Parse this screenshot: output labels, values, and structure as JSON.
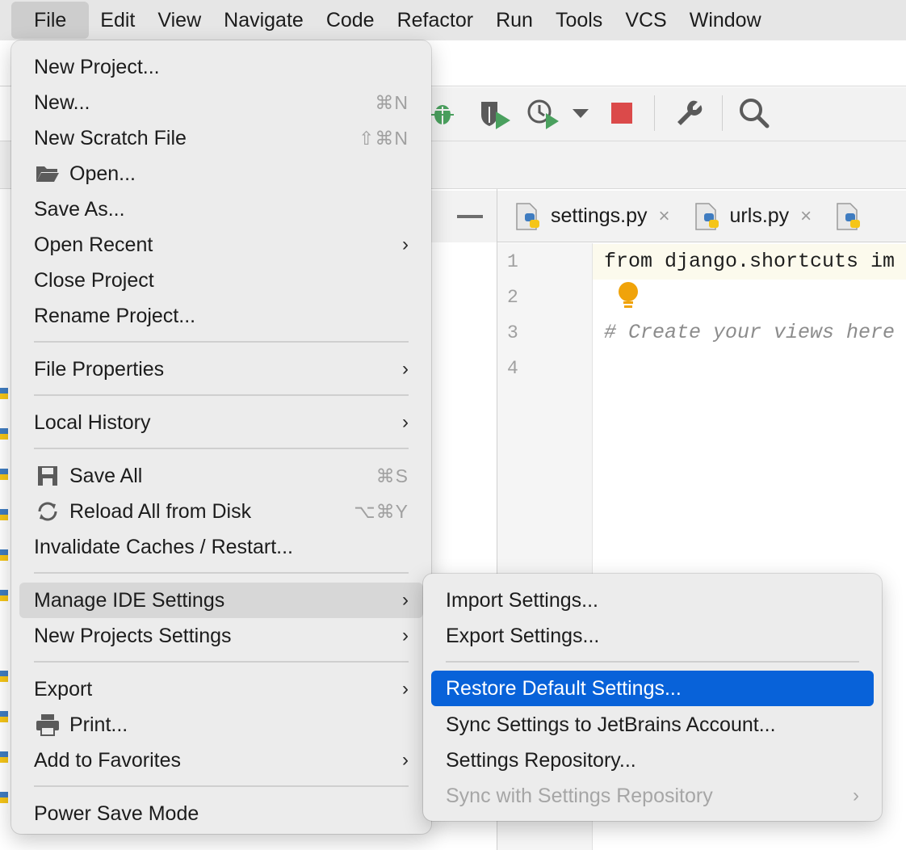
{
  "menubar": {
    "items": [
      "File",
      "Edit",
      "View",
      "Navigate",
      "Code",
      "Refactor",
      "Run",
      "Tools",
      "VCS",
      "Window"
    ]
  },
  "editor": {
    "tabs": [
      {
        "label": "settings.py",
        "close": "×"
      },
      {
        "label": "urls.py",
        "close": "×"
      }
    ],
    "line_numbers": [
      "1",
      "2",
      "3",
      "4"
    ],
    "code_lines": [
      "from django.shortcuts im",
      "# Create your views here"
    ]
  },
  "file_menu": {
    "items": [
      {
        "label": "New Project..."
      },
      {
        "label": "New...",
        "shortcut": "⌘N"
      },
      {
        "label": "New Scratch File",
        "shortcut": "⇧⌘N"
      },
      {
        "label": "Open...",
        "icon": "folder-icon"
      },
      {
        "label": "Save As..."
      },
      {
        "label": "Open Recent",
        "arrow": "›"
      },
      {
        "label": "Close Project"
      },
      {
        "label": "Rename Project..."
      },
      {
        "label": "File Properties",
        "arrow": "›"
      },
      {
        "label": "Local History",
        "arrow": "›"
      },
      {
        "label": "Save All",
        "shortcut": "⌘S",
        "icon": "save-icon"
      },
      {
        "label": "Reload All from Disk",
        "shortcut": "⌥⌘Y",
        "icon": "reload-icon"
      },
      {
        "label": "Invalidate Caches / Restart..."
      },
      {
        "label": "Manage IDE Settings",
        "arrow": "›"
      },
      {
        "label": "New Projects Settings",
        "arrow": "›"
      },
      {
        "label": "Export",
        "arrow": "›"
      },
      {
        "label": "Print...",
        "icon": "printer-icon"
      },
      {
        "label": "Add to Favorites",
        "arrow": "›"
      },
      {
        "label": "Power Save Mode"
      }
    ]
  },
  "settings_submenu": {
    "items": [
      {
        "label": "Import Settings..."
      },
      {
        "label": "Export Settings..."
      },
      {
        "label": "Restore Default Settings..."
      },
      {
        "label": "Sync Settings to JetBrains Account..."
      },
      {
        "label": "Settings Repository..."
      },
      {
        "label": "Sync with Settings Repository",
        "arrow": "›"
      }
    ]
  },
  "colors": {
    "selection": "#0862d9",
    "menu_bg": "#ececec",
    "hover": "#d7d7d7"
  }
}
